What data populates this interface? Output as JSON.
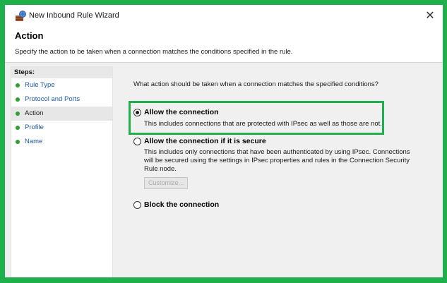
{
  "window": {
    "title": "New Inbound Rule Wizard",
    "close_glyph": "✕"
  },
  "header": {
    "title": "Action",
    "description": "Specify the action to be taken when a connection matches the conditions specified in the rule."
  },
  "steps": {
    "heading": "Steps:",
    "items": [
      {
        "label": "Rule Type",
        "current": false
      },
      {
        "label": "Protocol and Ports",
        "current": false
      },
      {
        "label": "Action",
        "current": true
      },
      {
        "label": "Profile",
        "current": false
      },
      {
        "label": "Name",
        "current": false
      }
    ]
  },
  "main": {
    "question": "What action should be taken when a connection matches the specified conditions?",
    "options": [
      {
        "label": "Allow the connection",
        "description": "This includes connections that are protected with IPsec as well as those are not.",
        "selected": true
      },
      {
        "label": "Allow the connection if it is secure",
        "description_lines": [
          "This includes only connections that have been authenticated by using IPsec.  Connections",
          "will be secured using the settings in IPsec properties and rules in the Connection Security",
          "Rule node."
        ],
        "selected": false
      },
      {
        "label": "Block the connection",
        "selected": false
      }
    ],
    "customize_button": "Customize..."
  },
  "colors": {
    "highlight": "#1fb04b",
    "step_link": "#1e5aa8",
    "step_dot": "#2f9e2f"
  },
  "icons": {
    "app": "firewall-wizard-icon",
    "close": "close-icon",
    "step_bullet": "green-dot-icon"
  }
}
